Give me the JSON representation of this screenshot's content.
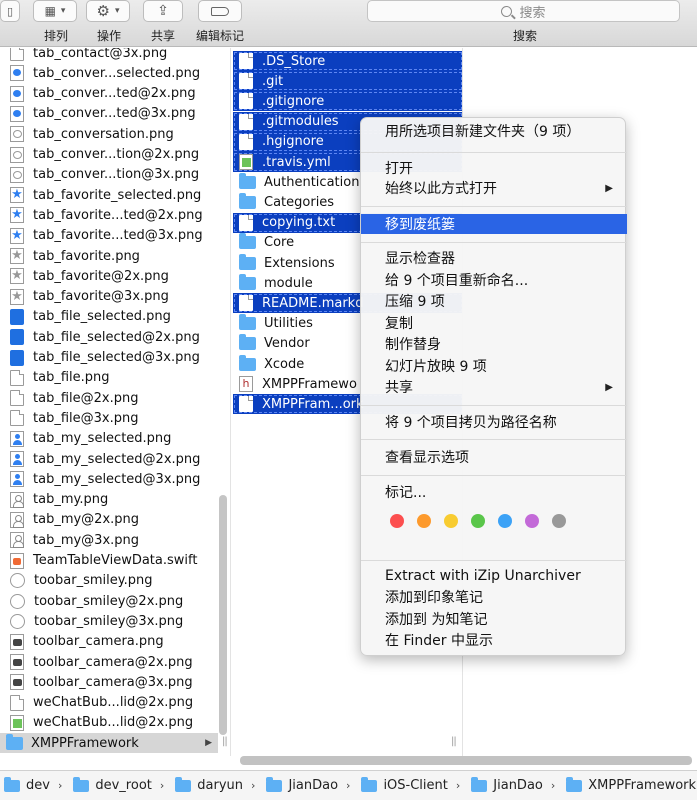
{
  "toolbar": {
    "arrange_label": "排列",
    "action_label": "操作",
    "share_label": "共享",
    "edit_tags_label": "编辑标记",
    "search_label": "搜索",
    "search_placeholder": "搜索"
  },
  "column1": {
    "items": [
      {
        "name": "tab_contact@3x.png",
        "icon": "doc"
      },
      {
        "name": "tab_conver...selected.png",
        "icon": "bubble"
      },
      {
        "name": "tab_conver...ted@2x.png",
        "icon": "bubble"
      },
      {
        "name": "tab_conver...ted@3x.png",
        "icon": "bubble"
      },
      {
        "name": "tab_conversation.png",
        "icon": "bubble-hollow"
      },
      {
        "name": "tab_conver...tion@2x.png",
        "icon": "bubble-hollow"
      },
      {
        "name": "tab_conver...tion@3x.png",
        "icon": "bubble-hollow"
      },
      {
        "name": "tab_favorite_selected.png",
        "icon": "star"
      },
      {
        "name": "tab_favorite...ted@2x.png",
        "icon": "star"
      },
      {
        "name": "tab_favorite...ted@3x.png",
        "icon": "star"
      },
      {
        "name": "tab_favorite.png",
        "icon": "star-hollow"
      },
      {
        "name": "tab_favorite@2x.png",
        "icon": "star-hollow"
      },
      {
        "name": "tab_favorite@3x.png",
        "icon": "star-hollow"
      },
      {
        "name": "tab_file_selected.png",
        "icon": "blue"
      },
      {
        "name": "tab_file_selected@2x.png",
        "icon": "blue"
      },
      {
        "name": "tab_file_selected@3x.png",
        "icon": "blue"
      },
      {
        "name": "tab_file.png",
        "icon": "doc"
      },
      {
        "name": "tab_file@2x.png",
        "icon": "doc"
      },
      {
        "name": "tab_file@3x.png",
        "icon": "doc"
      },
      {
        "name": "tab_my_selected.png",
        "icon": "person"
      },
      {
        "name": "tab_my_selected@2x.png",
        "icon": "person"
      },
      {
        "name": "tab_my_selected@3x.png",
        "icon": "person"
      },
      {
        "name": "tab_my.png",
        "icon": "person-hollow"
      },
      {
        "name": "tab_my@2x.png",
        "icon": "person-hollow"
      },
      {
        "name": "tab_my@3x.png",
        "icon": "person-hollow"
      },
      {
        "name": "TeamTableViewData.swift",
        "icon": "swift"
      },
      {
        "name": "toobar_smiley.png",
        "icon": "smiley"
      },
      {
        "name": "toobar_smiley@2x.png",
        "icon": "smiley"
      },
      {
        "name": "toobar_smiley@3x.png",
        "icon": "smiley"
      },
      {
        "name": "toolbar_camera.png",
        "icon": "camera"
      },
      {
        "name": "toolbar_camera@2x.png",
        "icon": "camera"
      },
      {
        "name": "toolbar_camera@3x.png",
        "icon": "camera"
      },
      {
        "name": "weChatBub...lid@2x.png",
        "icon": "doc"
      },
      {
        "name": "weChatBub...lid@2x.png",
        "icon": "green"
      },
      {
        "name": "XMPPFramework",
        "icon": "folder"
      }
    ]
  },
  "column2": {
    "items": [
      {
        "name": ".DS_Store",
        "icon": "doc",
        "selected": true
      },
      {
        "name": ".git",
        "icon": "doc",
        "selected": true
      },
      {
        "name": ".gitignore",
        "icon": "doc",
        "selected": true
      },
      {
        "name": ".gitmodules",
        "icon": "doc",
        "selected": true
      },
      {
        "name": ".hgignore",
        "icon": "doc",
        "selected": true
      },
      {
        "name": ".travis.yml",
        "icon": "green",
        "selected": true
      },
      {
        "name": "Authentication",
        "icon": "folder",
        "selected": false
      },
      {
        "name": "Categories",
        "icon": "folder",
        "selected": false
      },
      {
        "name": "copying.txt",
        "icon": "doc",
        "selected": true
      },
      {
        "name": "Core",
        "icon": "folder",
        "selected": false
      },
      {
        "name": "Extensions",
        "icon": "folder",
        "selected": false
      },
      {
        "name": "module",
        "icon": "folder",
        "selected": false
      },
      {
        "name": "README.markd",
        "icon": "doc",
        "selected": true
      },
      {
        "name": "Utilities",
        "icon": "folder",
        "selected": false
      },
      {
        "name": "Vendor",
        "icon": "folder",
        "selected": false
      },
      {
        "name": "Xcode",
        "icon": "folder",
        "selected": false
      },
      {
        "name": "XMPPFramewo",
        "icon": "hfile",
        "selected": false
      },
      {
        "name": "XMPPFram...ork",
        "icon": "doc",
        "selected": true
      }
    ]
  },
  "context_menu": {
    "new_folder_with_selection": "用所选项目新建文件夹（9 项）",
    "open": "打开",
    "open_with": "始终以此方式打开",
    "move_to_trash": "移到废纸篓",
    "show_inspector": "显示检查器",
    "rename_items": "给 9 个项目重新命名...",
    "compress": "压缩 9 项",
    "duplicate": "复制",
    "make_alias": "制作替身",
    "slideshow": "幻灯片放映 9 项",
    "share": "共享",
    "copy_as_pathname": "将 9 个项目拷贝为路径名称",
    "show_view_options": "查看显示选项",
    "tags": "标记...",
    "tag_colors": [
      "#fc4f4f",
      "#fd9a2d",
      "#f8cc31",
      "#5ac64a",
      "#3ca2f6",
      "#c36ad8",
      "#999999"
    ],
    "extract_izip": "Extract with iZip Unarchiver",
    "add_to_evernote": "添加到印象笔记",
    "add_to_weizhi": "添加到 为知笔记",
    "show_in_finder": "在 Finder 中显示"
  },
  "path_bar": {
    "crumbs": [
      "dev",
      "dev_root",
      "daryun",
      "JianDao",
      "iOS-Client",
      "JianDao",
      "XMPPFramework"
    ]
  },
  "colors": {
    "selection": "#0b3fbf",
    "menu_highlight": "#2a64e5",
    "folder": "#5db0f4"
  }
}
